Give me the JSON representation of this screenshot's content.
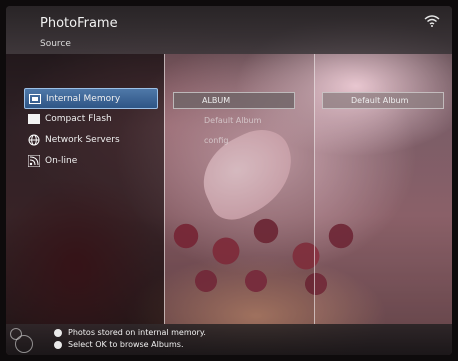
{
  "header": {
    "title": "PhotoFrame",
    "section": "Source"
  },
  "status": {
    "wifi_icon": "wifi-icon"
  },
  "sources": [
    {
      "label": "Internal Memory",
      "icon": "memory-icon",
      "selected": true
    },
    {
      "label": "Compact Flash",
      "icon": "card-icon",
      "selected": false
    },
    {
      "label": "Network Servers",
      "icon": "globe-icon",
      "selected": false
    },
    {
      "label": "On-line",
      "icon": "rss-icon",
      "selected": false
    }
  ],
  "middle": {
    "album_label": "ALBUM",
    "items": [
      "Default Album",
      "config"
    ]
  },
  "right": {
    "album_label": "Default Album"
  },
  "help": {
    "line1": "Photos stored on internal memory.",
    "line2": "Select OK to browse Albums."
  }
}
